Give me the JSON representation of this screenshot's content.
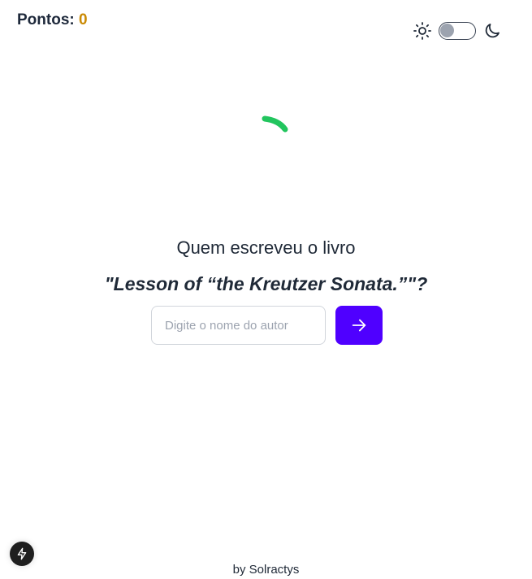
{
  "score": {
    "label": "Pontos:",
    "value": "0"
  },
  "theme_switch": {
    "left_icon": "sun-icon",
    "right_icon": "moon-icon",
    "state": "light"
  },
  "loading": {
    "icon": "spinner-icon",
    "color": "#22c55e"
  },
  "question": {
    "prompt": "Quem escreveu o livro",
    "book_title": "\"Lesson of “the Kreutzer Sonata.”\"?"
  },
  "form": {
    "placeholder": "Digite o nome do autor",
    "value": "",
    "submit_icon": "arrow-right-icon",
    "button_color": "#4f00ff"
  },
  "footer": {
    "credit": "by Solractys"
  },
  "badge": {
    "icon": "bolt-icon"
  },
  "colors": {
    "accent": "#4f00ff",
    "score_value": "#ca8a04",
    "spinner": "#22c55e"
  }
}
